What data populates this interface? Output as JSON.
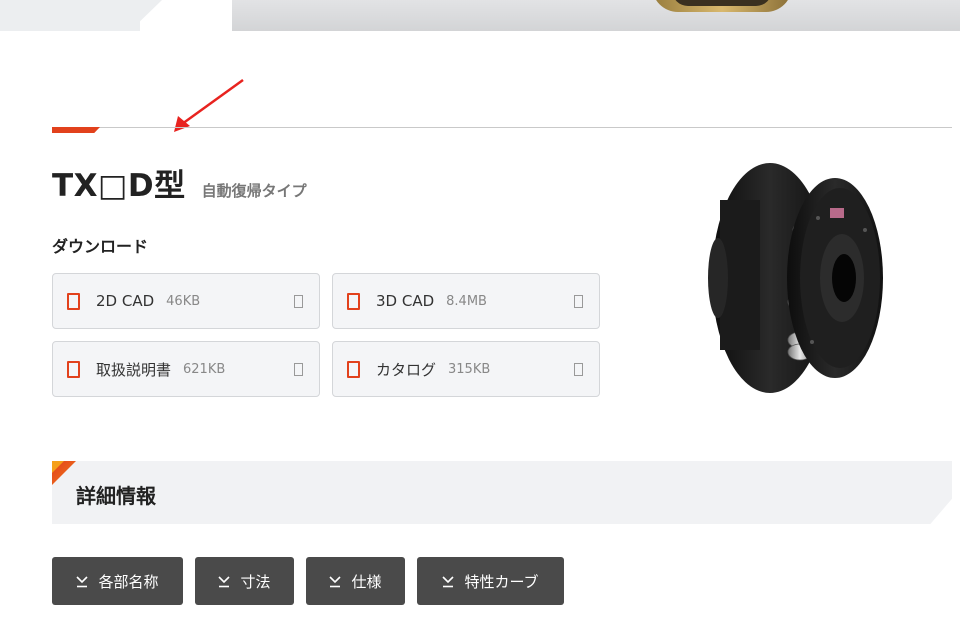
{
  "product": {
    "title": "TX□D型",
    "subtitle": "自動復帰タイプ"
  },
  "downloads": {
    "heading": "ダウンロード",
    "items": [
      {
        "label": "2D CAD",
        "size": "46KB"
      },
      {
        "label": "3D CAD",
        "size": "8.4MB"
      },
      {
        "label": "取扱説明書",
        "size": "621KB"
      },
      {
        "label": "カタログ",
        "size": "315KB"
      }
    ]
  },
  "details": {
    "heading": "詳細情報",
    "tabs": [
      {
        "label": "各部名称"
      },
      {
        "label": "寸法"
      },
      {
        "label": "仕様"
      },
      {
        "label": "特性カーブ"
      }
    ]
  },
  "colors": {
    "accent": "#e2411c",
    "button_bg": "#4a4a4a",
    "card_bg": "#f4f5f7",
    "section_bg": "#f1f2f4"
  }
}
